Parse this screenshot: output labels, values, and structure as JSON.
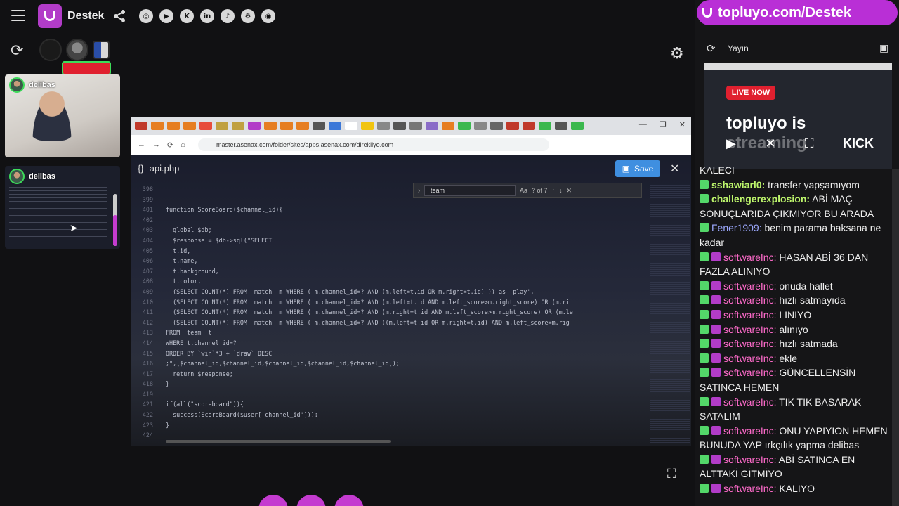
{
  "header": {
    "brand": "Destek",
    "social": [
      "instagram",
      "youtube",
      "kick",
      "linkedin",
      "tiktok",
      "steam",
      "github"
    ],
    "social_glyphs": [
      "◎",
      "▶",
      "K",
      "in",
      "♪",
      "⚙",
      "◉"
    ]
  },
  "cams": [
    {
      "name": "delibas"
    },
    {
      "name": "delibas"
    }
  ],
  "screen": {
    "url": "master.asenax.com/folder/sites/apps.asenax.com/direkliyo.com",
    "file": "api.php",
    "save_label": "Save",
    "find_value": "team",
    "find_count": "? of 7",
    "code": [
      {
        "n": "398",
        "t": ""
      },
      {
        "n": "399",
        "t": ""
      },
      {
        "n": "401",
        "t": "function ScoreBoard($channel_id){"
      },
      {
        "n": "402",
        "t": ""
      },
      {
        "n": "403",
        "t": "  global $db;"
      },
      {
        "n": "404",
        "t": "  $response = $db->sql(\"SELECT"
      },
      {
        "n": "405",
        "t": "  t.id,"
      },
      {
        "n": "406",
        "t": "  t.name,"
      },
      {
        "n": "407",
        "t": "  t.background,"
      },
      {
        "n": "408",
        "t": "  t.color,"
      },
      {
        "n": "409",
        "t": "  (SELECT COUNT(*) FROM  match  m WHERE ( m.channel_id=? AND (m.left=t.id OR m.right=t.id) )) as 'play',"
      },
      {
        "n": "410",
        "t": "  (SELECT COUNT(*) FROM  match  m WHERE ( m.channel_id=? AND (m.left=t.id AND m.left_score>m.right_score) OR (m.ri"
      },
      {
        "n": "411",
        "t": "  (SELECT COUNT(*) FROM  match  m WHERE ( m.channel_id=? AND (m.right=t.id AND m.left_score>m.right_score) OR (m.le"
      },
      {
        "n": "412",
        "t": "  (SELECT COUNT(*) FROM  match  m WHERE ( m.channel_id=? AND ((m.left=t.id OR m.right=t.id) AND m.left_score=m.rig"
      },
      {
        "n": "413",
        "t": "FROM  team  t"
      },
      {
        "n": "414",
        "t": "WHERE t.channel_id=?"
      },
      {
        "n": "415",
        "t": "ORDER BY `win`*3 + `draw` DESC"
      },
      {
        "n": "416",
        "t": ";\",[$channel_id,$channel_id,$channel_id,$channel_id,$channel_id]);"
      },
      {
        "n": "417",
        "t": "  return $response;"
      },
      {
        "n": "418",
        "t": "}"
      },
      {
        "n": "419",
        "t": ""
      },
      {
        "n": "421",
        "t": "if(all(\"scoreboard\")){"
      },
      {
        "n": "422",
        "t": "  success(ScoreBoard($user['channel_id']));"
      },
      {
        "n": "423",
        "t": "}"
      },
      {
        "n": "424",
        "t": ""
      }
    ]
  },
  "side": {
    "banner": "topluyo.com/Destek",
    "tab_label": "Yayın",
    "live_label": "LIVE NOW",
    "preview_title_1": "topluyo is",
    "preview_title_2": "streaming",
    "kick_label": "KICK"
  },
  "chat": [
    {
      "badges": [],
      "user": "",
      "text": "KALECI",
      "cls": ""
    },
    {
      "badges": [
        "k"
      ],
      "user": "sshawiarl0:",
      "text": "transfer yapşamıyom",
      "cls": "u1"
    },
    {
      "badges": [
        "k"
      ],
      "user": "challengerexplosion:",
      "text": "ABİ MAÇ SONUÇLARIDA ÇIKMIYOR BU ARADA",
      "cls": "u1"
    },
    {
      "badges": [
        "k"
      ],
      "user": "Fener1909:",
      "text": "benim parama baksana ne kadar",
      "cls": "u2"
    },
    {
      "badges": [
        "k",
        "p"
      ],
      "user": "softwareInc:",
      "text": "HASAN ABİ 36 DAN FAZLA ALINIYO",
      "cls": "u3"
    },
    {
      "badges": [
        "k",
        "p"
      ],
      "user": "softwareInc:",
      "text": "onuda hallet",
      "cls": "u3"
    },
    {
      "badges": [
        "k",
        "p"
      ],
      "user": "softwareInc:",
      "text": "hızlı satmayıda",
      "cls": "u3"
    },
    {
      "badges": [
        "k",
        "p"
      ],
      "user": "softwareInc:",
      "text": "LINIYO",
      "cls": "u3"
    },
    {
      "badges": [
        "k",
        "p"
      ],
      "user": "softwareInc:",
      "text": "alınıyo",
      "cls": "u3"
    },
    {
      "badges": [
        "k",
        "p"
      ],
      "user": "softwareInc:",
      "text": "hızlı satmada",
      "cls": "u3"
    },
    {
      "badges": [
        "k",
        "p"
      ],
      "user": "softwareInc:",
      "text": "ekle",
      "cls": "u3"
    },
    {
      "badges": [
        "k",
        "p"
      ],
      "user": "softwareInc:",
      "text": "GÜNCELLENSİN SATINCA HEMEN",
      "cls": "u3"
    },
    {
      "badges": [
        "k",
        "p"
      ],
      "user": "softwareInc:",
      "text": "TIK TIK BASARAK SATALIM",
      "cls": "u3"
    },
    {
      "badges": [
        "k",
        "p"
      ],
      "user": "softwareInc:",
      "text": "ONU YAPIYION HEMEN BUNUDA YAP ırkçılık yapma delibas",
      "cls": "u3"
    },
    {
      "badges": [
        "k",
        "p"
      ],
      "user": "softwareInc:",
      "text": "ABİ SATINCA EN ALTTAKİ GİTMİYO",
      "cls": "u3"
    },
    {
      "badges": [
        "k",
        "p"
      ],
      "user": "softwareInc:",
      "text": "KALIYO",
      "cls": "u3"
    }
  ],
  "colors": {
    "accent": "#b23cc8",
    "live": "#e0202f",
    "kick": "#53d769",
    "save": "#3f8fe0"
  }
}
